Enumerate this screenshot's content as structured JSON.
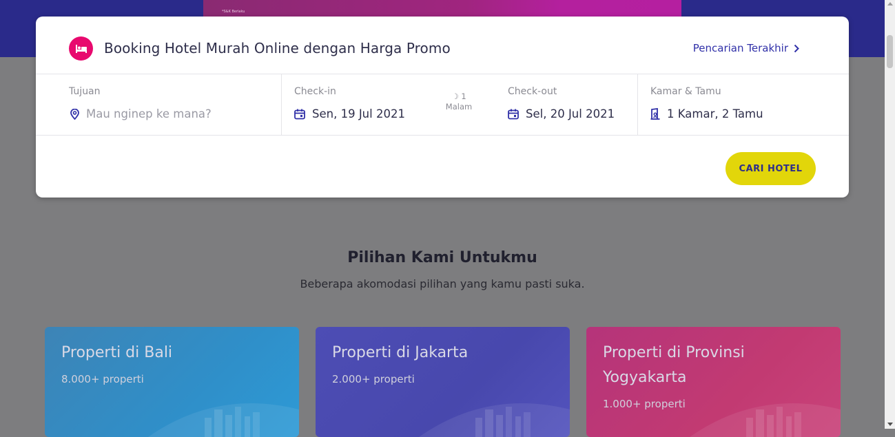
{
  "hero": {
    "banner_text": "*S&K Berlaku"
  },
  "booking": {
    "title": "Booking Hotel Murah Online dengan Harga Promo",
    "icon": "hotel-bed-icon",
    "recent_search_label": "Pencarian Terakhir",
    "destination": {
      "label": "Tujuan",
      "placeholder": "Mau nginep ke mana?"
    },
    "checkin": {
      "label": "Check-in",
      "value": "Sen, 19 Jul 2021"
    },
    "nights": {
      "count": "1",
      "unit": "Malam"
    },
    "checkout": {
      "label": "Check-out",
      "value": "Sel, 20 Jul 2021"
    },
    "rooms": {
      "label": "Kamar & Tamu",
      "value": "1 Kamar, 2 Tamu"
    },
    "search_button": "CARI HOTEL"
  },
  "section": {
    "title": "Pilihan Kami Untukmu",
    "subtitle": "Beberapa akomodasi pilihan yang kamu pasti suka."
  },
  "properties": [
    {
      "title": "Properti di Bali",
      "count": "8.000+ properti"
    },
    {
      "title": "Properti di Jakarta",
      "count": "2.000+ properti"
    },
    {
      "title": "Properti di Provinsi Yogyakarta",
      "count": "1.000+ properti"
    }
  ],
  "colors": {
    "brand_navy": "#2a2a8a",
    "accent_pink": "#e8096e",
    "button_yellow": "#e2d60a",
    "link_blue": "#3030a8"
  }
}
